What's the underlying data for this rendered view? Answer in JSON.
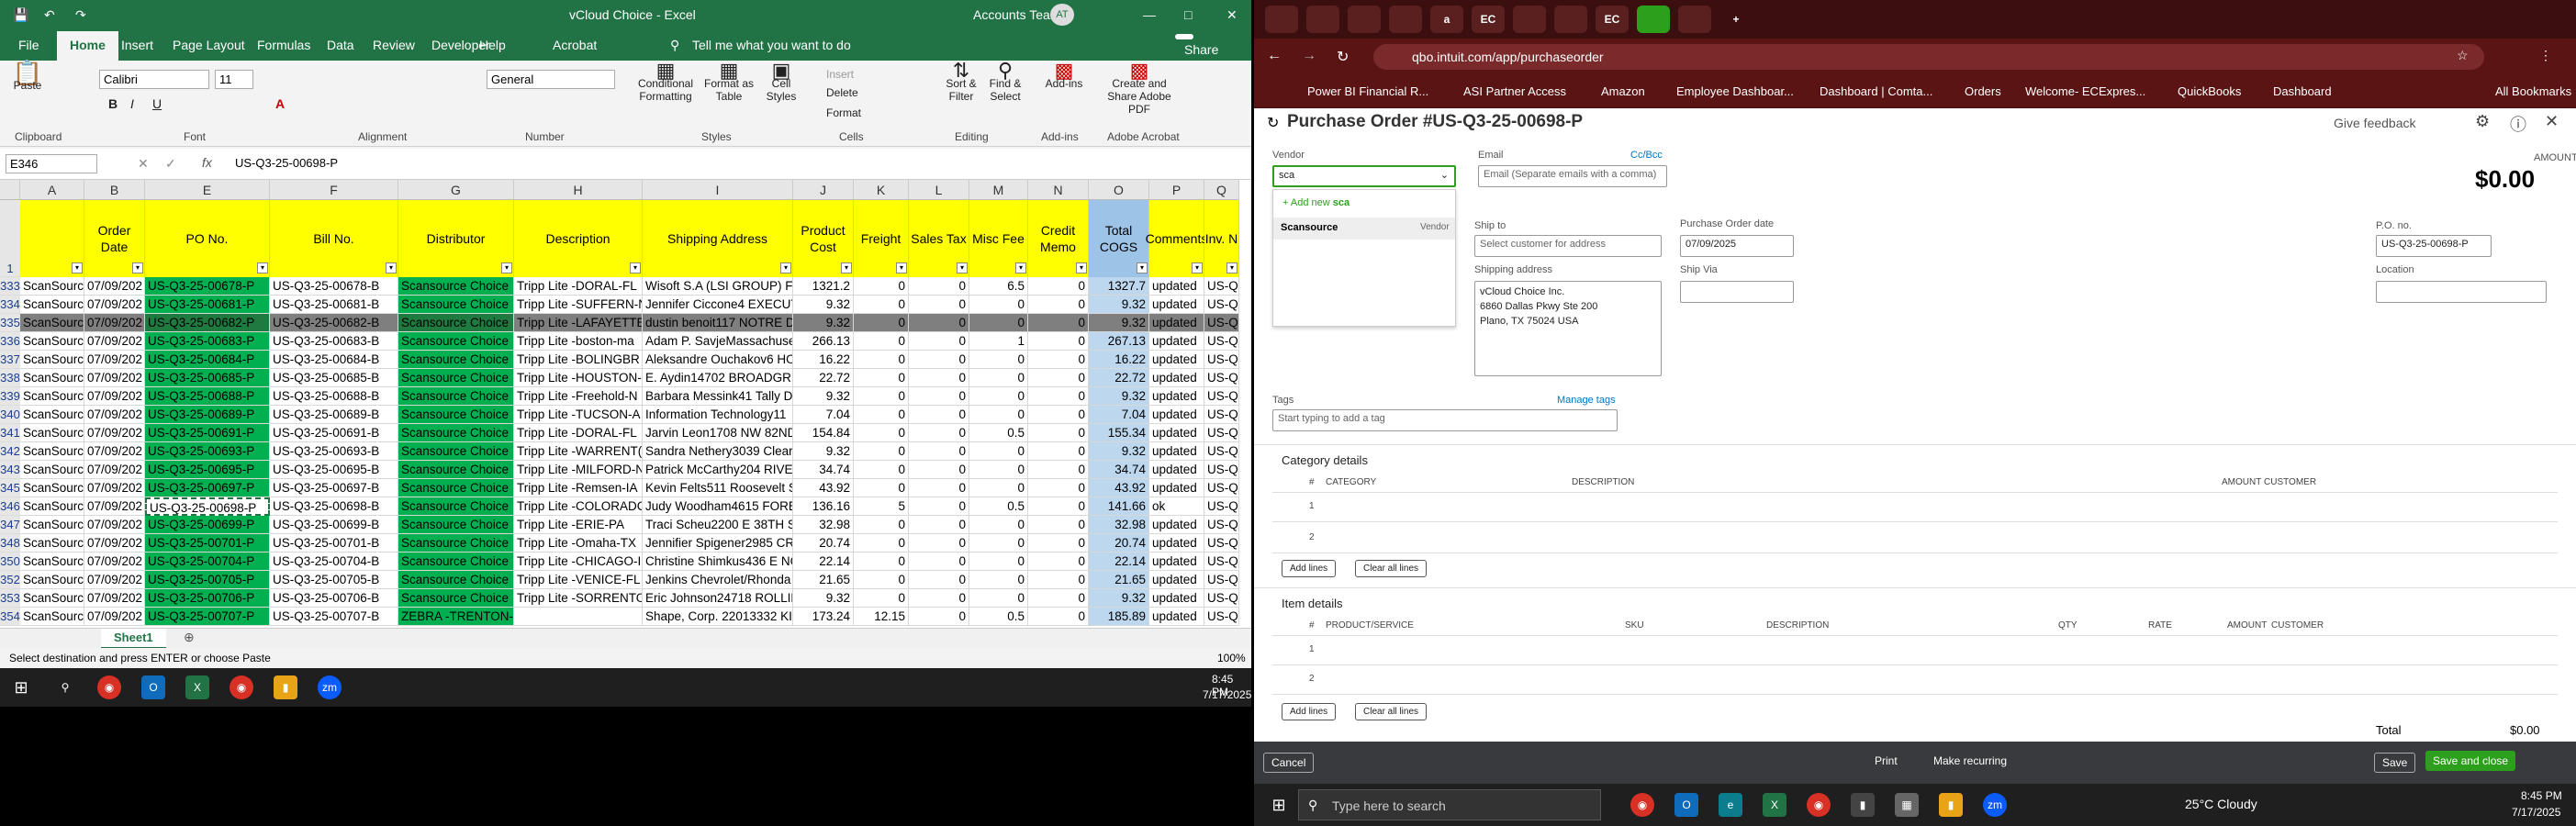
{
  "excel": {
    "title": "vCloud Choice  -  Excel",
    "account": "Accounts Team",
    "avatar": "AT",
    "menu": [
      "File",
      "Home",
      "Insert",
      "Page Layout",
      "Formulas",
      "Data",
      "Review",
      "Developer",
      "Help",
      "Acrobat"
    ],
    "tell_me": "Tell me what you want to do",
    "share": "Share",
    "ribbon": {
      "paste": "Paste",
      "font_name": "Calibri",
      "font_size": "11",
      "number_format": "General",
      "insert": "Insert",
      "delete": "Delete",
      "format": "Format",
      "conditional": "Conditional Formatting",
      "format_as_table": "Format as Table",
      "cell_styles": "Cell Styles",
      "sort_filter": "Sort & Filter",
      "find_select": "Find & Select",
      "addins": "Add-ins",
      "create_pdf": "Create and Share Adobe PDF",
      "groups": [
        "Clipboard",
        "Font",
        "Alignment",
        "Number",
        "Styles",
        "Cells",
        "Editing",
        "Add-ins",
        "Adobe Acrobat"
      ]
    },
    "name_box": "E346",
    "formula": "US-Q3-25-00698-P",
    "col_letters": [
      "A",
      "B",
      "E",
      "F",
      "G",
      "H",
      "I",
      "J",
      "K",
      "L",
      "M",
      "N",
      "O",
      "P",
      "Q"
    ],
    "headers": [
      "",
      "Order Date",
      "PO No.",
      "Bill No.",
      "Distributor",
      "Description",
      "Shipping Address",
      "Product Cost",
      "Freight",
      "Sales Tax",
      "Misc Fee",
      "Credit Memo",
      "Total COGS",
      "Comments",
      "Inv. N"
    ],
    "header_row_num": "1",
    "rows": [
      {
        "n": "333",
        "a": "ScanSourc",
        "b": "07/09/202",
        "e": "US-Q3-25-00678-P",
        "f": "US-Q3-25-00678-B",
        "g": "Scansource Choice",
        "h": "Tripp Lite -DORAL-FL",
        "i": "Wisoft S.A (LSI GROUP) FB(",
        "j": "1321.2",
        "k": "0",
        "l": "0",
        "m": "6.5",
        "nn": "0",
        "o": "1327.7",
        "p": "updated",
        "q": "US-Q3"
      },
      {
        "n": "334",
        "a": "ScanSourc",
        "b": "07/09/202",
        "e": "US-Q3-25-00681-P",
        "f": "US-Q3-25-00681-B",
        "g": "Scansource Choice",
        "h": "Tripp Lite -SUFFERN-N",
        "i": "Jennifer Ciccone4 EXECUTI",
        "j": "9.32",
        "k": "0",
        "l": "0",
        "m": "0",
        "nn": "0",
        "o": "9.32",
        "p": "updated",
        "q": "US-Q3"
      },
      {
        "n": "335",
        "a": "ScanSourc",
        "b": "07/09/202",
        "e": "US-Q3-25-00682-P",
        "f": "US-Q3-25-00682-B",
        "g": "Scansource Choice",
        "h": "Tripp Lite -LAFAYETTE",
        "i": "dustin benoit117 NOTRE D",
        "j": "9.32",
        "k": "0",
        "l": "0",
        "m": "0",
        "nn": "0",
        "o": "9.32",
        "p": "updated",
        "q": "US-Q3"
      },
      {
        "n": "336",
        "a": "ScanSourc",
        "b": "07/09/202",
        "e": "US-Q3-25-00683-P",
        "f": "US-Q3-25-00683-B",
        "g": "Scansource Choice",
        "h": "Tripp Lite -boston-ma",
        "i": "Adam P. SavjeMassachuse",
        "j": "266.13",
        "k": "0",
        "l": "0",
        "m": "1",
        "nn": "0",
        "o": "267.13",
        "p": "updated",
        "q": "US-Q3"
      },
      {
        "n": "337",
        "a": "ScanSourc",
        "b": "07/09/202",
        "e": "US-Q3-25-00684-P",
        "f": "US-Q3-25-00684-B",
        "g": "Scansource Choice",
        "h": "Tripp Lite -BOLINGBR",
        "i": "Aleksandre Ouchakov6 HO",
        "j": "16.22",
        "k": "0",
        "l": "0",
        "m": "0",
        "nn": "0",
        "o": "16.22",
        "p": "updated",
        "q": "US-Q3"
      },
      {
        "n": "338",
        "a": "ScanSourc",
        "b": "07/09/202",
        "e": "US-Q3-25-00685-P",
        "f": "US-Q3-25-00685-B",
        "g": "Scansource Choice",
        "h": "Tripp Lite -HOUSTON-",
        "i": "E. Aydin14702 BROADGRE",
        "j": "22.72",
        "k": "0",
        "l": "0",
        "m": "0",
        "nn": "0",
        "o": "22.72",
        "p": "updated",
        "q": "US-Q3"
      },
      {
        "n": "339",
        "a": "ScanSourc",
        "b": "07/09/202",
        "e": "US-Q3-25-00688-P",
        "f": "US-Q3-25-00688-B",
        "g": "Scansource Choice",
        "h": "Tripp Lite -Freehold-N",
        "i": "Barbara Messink41 Tally D",
        "j": "9.32",
        "k": "0",
        "l": "0",
        "m": "0",
        "nn": "0",
        "o": "9.32",
        "p": "updated",
        "q": "US-Q3"
      },
      {
        "n": "340",
        "a": "ScanSourc",
        "b": "07/09/202",
        "e": "US-Q3-25-00689-P",
        "f": "US-Q3-25-00689-B",
        "g": "Scansource Choice",
        "h": "Tripp Lite -TUCSON-A",
        "i": "Information Technology11",
        "j": "7.04",
        "k": "0",
        "l": "0",
        "m": "0",
        "nn": "0",
        "o": "7.04",
        "p": "updated",
        "q": "US-Q3"
      },
      {
        "n": "341",
        "a": "ScanSourc",
        "b": "07/09/202",
        "e": "US-Q3-25-00691-P",
        "f": "US-Q3-25-00691-B",
        "g": "Scansource Choice",
        "h": "Tripp Lite -DORAL-FL",
        "i": "Jarvin Leon1708 NW 82ND",
        "j": "154.84",
        "k": "0",
        "l": "0",
        "m": "0.5",
        "nn": "0",
        "o": "155.34",
        "p": "updated",
        "q": "US-Q3"
      },
      {
        "n": "342",
        "a": "ScanSourc",
        "b": "07/09/202",
        "e": "US-Q3-25-00693-P",
        "f": "US-Q3-25-00693-B",
        "g": "Scansource Choice",
        "h": "Tripp Lite -WARRENT(",
        "i": "Sandra Nethery3039 Clear",
        "j": "9.32",
        "k": "0",
        "l": "0",
        "m": "0",
        "nn": "0",
        "o": "9.32",
        "p": "updated",
        "q": "US-Q3"
      },
      {
        "n": "343",
        "a": "ScanSourc",
        "b": "07/09/202",
        "e": "US-Q3-25-00695-P",
        "f": "US-Q3-25-00695-B",
        "g": "Scansource Choice",
        "h": "Tripp Lite -MILFORD-N",
        "i": "Patrick McCarthy204 RIVEF",
        "j": "34.74",
        "k": "0",
        "l": "0",
        "m": "0",
        "nn": "0",
        "o": "34.74",
        "p": "updated",
        "q": "US-Q3"
      },
      {
        "n": "345",
        "a": "ScanSourc",
        "b": "07/09/202",
        "e": "US-Q3-25-00697-P",
        "f": "US-Q3-25-00697-B",
        "g": "Scansource Choice",
        "h": "Tripp Lite -Remsen-IA",
        "i": "Kevin Felts511 Roosevelt S",
        "j": "43.92",
        "k": "0",
        "l": "0",
        "m": "0",
        "nn": "0",
        "o": "43.92",
        "p": "updated",
        "q": "US-Q3"
      },
      {
        "n": "346",
        "a": "ScanSourc",
        "b": "07/09/202",
        "e": "US-Q3-25-00698-P",
        "f": "US-Q3-25-00698-B",
        "g": "Scansource Choice",
        "h": "Tripp Lite -COLORADC",
        "i": "Judy Woodham4615 FORE!",
        "j": "136.16",
        "k": "5",
        "l": "0",
        "m": "0.5",
        "nn": "0",
        "o": "141.66",
        "p": "ok",
        "q": "US-Q3"
      },
      {
        "n": "347",
        "a": "ScanSourc",
        "b": "07/09/202",
        "e": "US-Q3-25-00699-P",
        "f": "US-Q3-25-00699-B",
        "g": "Scansource Choice",
        "h": "Tripp Lite -ERIE-PA",
        "i": "Traci Scheu2200 E 38TH ST,",
        "j": "32.98",
        "k": "0",
        "l": "0",
        "m": "0",
        "nn": "0",
        "o": "32.98",
        "p": "updated",
        "q": "US-Q3"
      },
      {
        "n": "348",
        "a": "ScanSourc",
        "b": "07/09/202",
        "e": "US-Q3-25-00701-P",
        "f": "US-Q3-25-00701-B",
        "g": "Scansource Choice",
        "h": "Tripp Lite -Omaha-TX",
        "i": "Jennifier Spigener2985 CR",
        "j": "20.74",
        "k": "0",
        "l": "0",
        "m": "0",
        "nn": "0",
        "o": "20.74",
        "p": "updated",
        "q": "US-Q3"
      },
      {
        "n": "350",
        "a": "ScanSourc",
        "b": "07/09/202",
        "e": "US-Q3-25-00704-P",
        "f": "US-Q3-25-00704-B",
        "g": "Scansource Choice",
        "h": "Tripp Lite -CHICAGO-I",
        "i": "Christine Shimkus436 E NC",
        "j": "22.14",
        "k": "0",
        "l": "0",
        "m": "0",
        "nn": "0",
        "o": "22.14",
        "p": "updated",
        "q": "US-Q3"
      },
      {
        "n": "352",
        "a": "ScanSourc",
        "b": "07/09/202",
        "e": "US-Q3-25-00705-P",
        "f": "US-Q3-25-00705-B",
        "g": "Scansource Choice",
        "h": "Tripp Lite -VENICE-FL",
        "i": "Jenkins Chevrolet/Rhonda",
        "j": "21.65",
        "k": "0",
        "l": "0",
        "m": "0",
        "nn": "0",
        "o": "21.65",
        "p": "updated",
        "q": "US-Q3"
      },
      {
        "n": "353",
        "a": "ScanSourc",
        "b": "07/09/202",
        "e": "US-Q3-25-00706-P",
        "f": "US-Q3-25-00706-B",
        "g": "Scansource Choice",
        "h": "Tripp Lite -SORRENTO",
        "i": "Eric Johnson24718 ROLLIN",
        "j": "9.32",
        "k": "0",
        "l": "0",
        "m": "0",
        "nn": "0",
        "o": "9.32",
        "p": "updated",
        "q": "US-Q3"
      },
      {
        "n": "354",
        "a": "ScanSourc",
        "b": "07/09/202",
        "e": "US-Q3-25-00707-P",
        "f": "US-Q3-25-00707-B",
        "g": "ZEBRA -TRENTON-OH",
        "i": "Shape, Corp. 22013332 KIN",
        "h": "",
        "j": "173.24",
        "k": "12.15",
        "l": "0",
        "m": "0.5",
        "nn": "0",
        "o": "185.89",
        "p": "updated",
        "q": "US-Q3"
      }
    ],
    "sheet_tab": "Sheet1",
    "status": "Select destination and press ENTER or choose Paste",
    "zoom": "100%"
  },
  "browser": {
    "url": "qbo.intuit.com/app/purchaseorder",
    "bookmarks": [
      "Power BI Financial R...",
      "ASI Partner Access",
      "Amazon",
      "Employee Dashboar...",
      "Dashboard | Comta...",
      "Orders",
      "Welcome- ECExpres...",
      "QuickBooks",
      "Dashboard",
      "All Bookmarks"
    ],
    "tab_icons": [
      "",
      "",
      "",
      "",
      "a",
      "EC",
      "",
      "",
      "EC",
      "",
      ""
    ]
  },
  "qbo": {
    "title": "Purchase Order #US-Q3-25-00698-P",
    "give_feedback": "Give feedback",
    "vendor_label": "Vendor",
    "vendor_value": "sca",
    "add_new": "+ Add new",
    "add_new_term": "sca",
    "dropdown_item": "Scansource",
    "dropdown_item_type": "Vendor",
    "email_label": "Email",
    "cc_bcc": "Cc/Bcc",
    "email_placeholder": "Email (Separate emails with a comma)",
    "amount_label": "AMOUNT",
    "amount": "$0.00",
    "ship_to_label": "Ship to",
    "ship_to_placeholder": "Select customer for address",
    "po_date_label": "Purchase Order date",
    "po_date": "07/09/2025",
    "po_no_label": "P.O. no.",
    "po_no": "US-Q3-25-00698-P",
    "shipping_address_label": "Shipping address",
    "shipping_address": [
      "vCloud Choice Inc.",
      "6860 Dallas Pkwy Ste 200",
      "Plano, TX  75024 USA"
    ],
    "ship_via_label": "Ship Via",
    "location_label": "Location",
    "tags_label": "Tags",
    "manage_tags": "Manage tags",
    "tags_placeholder": "Start typing to add a tag",
    "category_details": "Category details",
    "cat_headers": [
      "#",
      "CATEGORY",
      "DESCRIPTION",
      "AMOUNT",
      "CUSTOMER"
    ],
    "item_details": "Item details",
    "item_headers": [
      "#",
      "PRODUCT/SERVICE",
      "SKU",
      "DESCRIPTION",
      "QTY",
      "RATE",
      "AMOUNT",
      "CUSTOMER"
    ],
    "line_numbers": [
      "1",
      "2"
    ],
    "add_lines": "Add lines",
    "clear_all_lines": "Clear all lines",
    "total_label": "Total",
    "total": "$0.00",
    "cancel": "Cancel",
    "print": "Print",
    "make_recurring": "Make recurring",
    "save": "Save",
    "save_close": "Save and close"
  },
  "taskbar": {
    "time1": "8:45 PM",
    "date1": "7/17/2025",
    "search_placeholder": "Type here to search",
    "weather": "25°C  Cloudy",
    "time2": "8:45 PM",
    "date2": "7/17/2025"
  },
  "colors": {
    "excel_green": "#217346",
    "green_fill": "#00b050",
    "yellow_fill": "#ffff00",
    "qbo_green": "#2ca01c",
    "browser_maroon": "#5a1414"
  }
}
